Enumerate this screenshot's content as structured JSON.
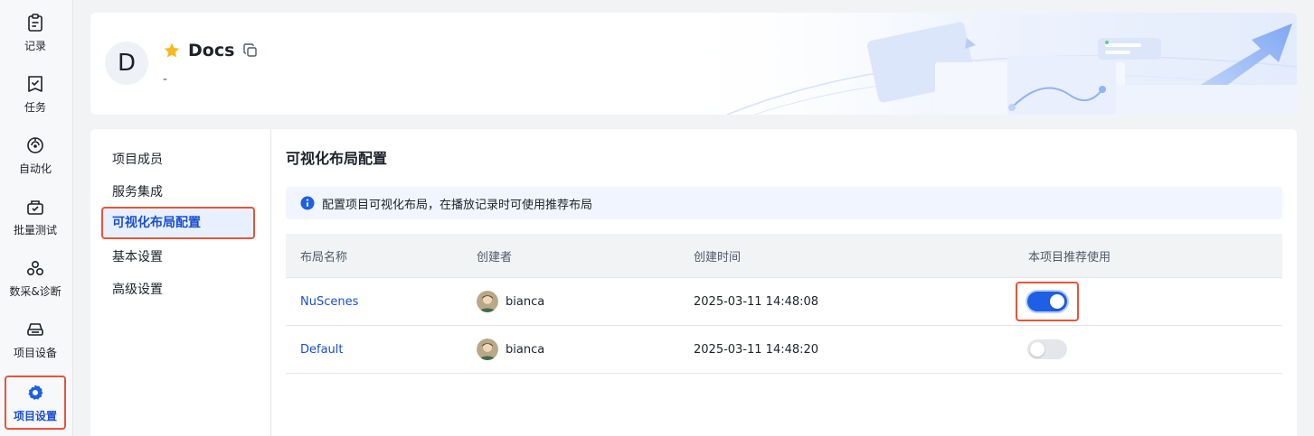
{
  "nav": {
    "items": [
      {
        "label": "记录",
        "icon": "clipboard-icon"
      },
      {
        "label": "任务",
        "icon": "task-check-icon"
      },
      {
        "label": "自动化",
        "icon": "automation-icon"
      },
      {
        "label": "批量测试",
        "icon": "batch-test-icon"
      },
      {
        "label": "数采&诊断",
        "icon": "diagnosis-icon"
      },
      {
        "label": "项目设备",
        "icon": "device-icon"
      },
      {
        "label": "项目设置",
        "icon": "gear-icon",
        "active": true
      }
    ]
  },
  "header": {
    "avatar_letter": "D",
    "title": "Docs",
    "subtitle": "-",
    "star_color": "#f7ba1e"
  },
  "submenu": {
    "items": [
      {
        "label": "项目成员"
      },
      {
        "label": "服务集成"
      },
      {
        "label": "可视化布局配置",
        "active": true
      },
      {
        "label": "基本设置"
      },
      {
        "label": "高级设置"
      }
    ]
  },
  "main": {
    "section_title": "可视化布局配置",
    "info_text": "配置项目可视化布局，在播放记录时可使用推荐布局",
    "table": {
      "headers": [
        "布局名称",
        "创建者",
        "创建时间",
        "本项目推荐使用"
      ],
      "rows": [
        {
          "name": "NuScenes",
          "creator": "bianca",
          "created": "2025-03-11 14:48:08",
          "recommended": true
        },
        {
          "name": "Default",
          "creator": "bianca",
          "created": "2025-03-11 14:48:20",
          "recommended": false
        }
      ]
    }
  },
  "colors": {
    "accent": "#1a4fd1",
    "toggle_on": "#1e5fe3",
    "highlight_border": "#e4553b"
  }
}
